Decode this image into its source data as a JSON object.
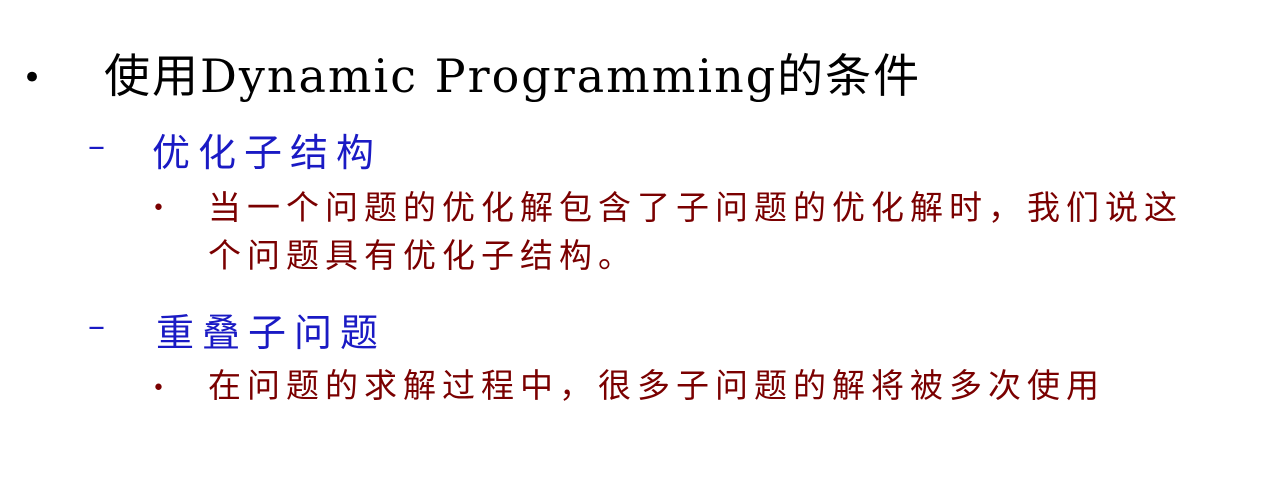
{
  "bullet_symbol": "•",
  "dash_symbol": "–",
  "heading": "使用Dynamic Programming的条件",
  "sections": [
    {
      "title": "优化子结构",
      "detail_line1": "当一个问题的优化解包含了子问题的优化解时，我们说这",
      "detail_line2": "个问题具有优化子结构。"
    },
    {
      "title": "重叠子问题",
      "detail_line1": "在问题的求解过程中，很多子问题的解将被多次使用"
    }
  ],
  "colors": {
    "heading": "#000000",
    "subheading": "#1a1ac4",
    "detail": "#7a0000"
  }
}
